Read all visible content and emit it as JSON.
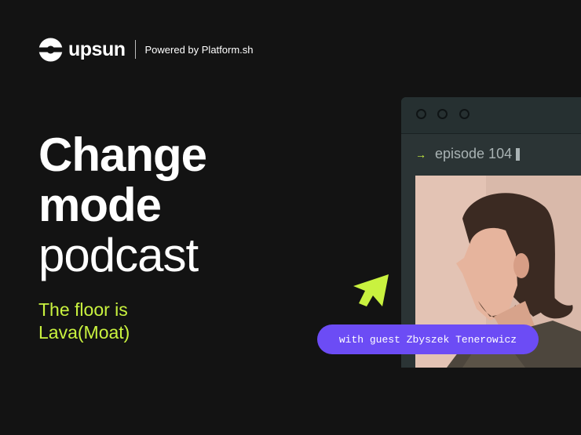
{
  "brand": {
    "name": "upsun",
    "powered_by": "Powered by Platform.sh"
  },
  "title": {
    "line1": "Change",
    "line2": "mode",
    "line3": "podcast"
  },
  "subtitle": {
    "line1": "The floor is",
    "line2": "Lava(Moat)"
  },
  "window": {
    "episode_arrow": "→",
    "episode_label": "episode 104"
  },
  "guest": {
    "label": "with guest Zbyszek Tenerowicz"
  },
  "colors": {
    "background": "#131313",
    "accent_lime": "#c9f23f",
    "pill_purple": "#6c4cf5",
    "window": "#2b3435"
  },
  "icons": [
    "upsun-logo-icon",
    "arrow-cursor-icon"
  ]
}
